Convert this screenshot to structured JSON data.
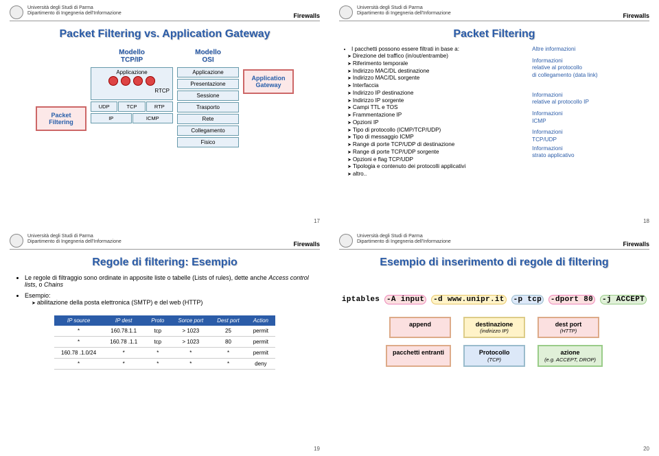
{
  "common": {
    "uni": "Università degli Studi di Parma",
    "dept": "Dipartimento di Ingegneria dell'Informazione",
    "topic": "Firewalls"
  },
  "s17": {
    "title": "Packet Filtering vs. Application Gateway",
    "pf": "Packet\nFiltering",
    "ag": "Application\nGateway",
    "tcpip_h1": "Modello",
    "tcpip_h2": "TCP/IP",
    "osi_h1": "Modello",
    "osi_h2": "OSI",
    "tcpip_app": "Applicazione",
    "tcpip_rtcp": "RTCP",
    "tcpip_udp": "UDP",
    "tcpip_tcp": "TCP",
    "tcpip_rtp": "RTP",
    "tcpip_ip": "IP",
    "tcpip_icmp": "ICMP",
    "osi": [
      "Applicazione",
      "Presentazione",
      "Sessione",
      "Trasporto",
      "Rete",
      "Collegamento",
      "Fisico"
    ],
    "page": "17"
  },
  "s18": {
    "title": "Packet Filtering",
    "lead": "I pacchetti possono essere filtrati in base a:",
    "items": [
      "Direzione del traffico (in/out/entrambe)",
      "Riferimento temporale",
      "Indirizzo MAC/DL destinazione",
      "Indirizzo MAC/DL sorgente",
      "Interfaccia",
      "Indirizzo IP destinazione",
      "Indirizzo IP sorgente",
      "Campi TTL e TOS",
      "Frammentazione IP",
      "Opzioni IP",
      "Tipo di protocollo (ICMP/TCP/UDP)",
      "Tipo di messaggio ICMP",
      "Range di porte TCP/UDP di destinazione",
      "Range di porte TCP/UDP sorgente",
      "Opzioni e flag TCP/UDP",
      "Tipologia e contenuto dei protocolli applicativi",
      "altro.."
    ],
    "r_other": "Altre informazioni",
    "r_dl1": "Informazioni",
    "r_dl2": "relative al protocollo",
    "r_dl3": "di collegamento (data link)",
    "r_ip1": "Informazioni",
    "r_ip2": "relative al protocollo IP",
    "r_icmp1": "Informazioni",
    "r_icmp2": "ICMP",
    "r_tcp1": "Informazioni",
    "r_tcp2": "TCP/UDP",
    "r_app1": "Informazioni",
    "r_app2": "strato applicativo",
    "page": "18"
  },
  "s19": {
    "title": "Regole di filtering: Esempio",
    "b1": "Le regole di filtraggio sono ordinate in apposite liste o tabelle (Lists of rules), dette anche ",
    "b1i": "Access control lists",
    "b1mid": ", o ",
    "b1i2": "Chains",
    "b2": "Esempio:",
    "b2s": "abilitazione della posta elettronica (SMTP) e del web (HTTP)",
    "th": [
      "IP source",
      "IP dest",
      "Proto",
      "Sorce port",
      "Dest port",
      "Action"
    ],
    "rows": [
      [
        "*",
        "160.78.1.1",
        "tcp",
        "> 1023",
        "25",
        "permit"
      ],
      [
        "*",
        "160.78 .1.1",
        "tcp",
        "> 1023",
        "80",
        "permit"
      ],
      [
        "160.78 .1.0/24",
        "*",
        "*",
        "*",
        "*",
        "permit"
      ],
      [
        "*",
        "*",
        "*",
        "*",
        "*",
        "deny"
      ]
    ],
    "page": "19"
  },
  "s20": {
    "title": "Esempio di inserimento di regole di filtering",
    "cmd_p0": "iptables",
    "cmd_p1": "-A input",
    "cmd_p2": "-d www.unipr.it",
    "cmd_p3": "-p tcp",
    "cmd_p4": "-dport 80",
    "cmd_p5": "-j ACCEPT",
    "lg": {
      "append_t": "append",
      "append_s": "",
      "pin_t": "pacchetti entranti",
      "pin_s": "",
      "dest_t": "destinazione",
      "dest_s": "(indirizzo IP)",
      "proto_t": "Protocollo",
      "proto_s": "(TCP)",
      "dport_t": "dest port",
      "dport_s": "(HTTP)",
      "act_t": "azione",
      "act_s": "(e.g. ACCEPT, DROP)"
    },
    "page": "20"
  }
}
